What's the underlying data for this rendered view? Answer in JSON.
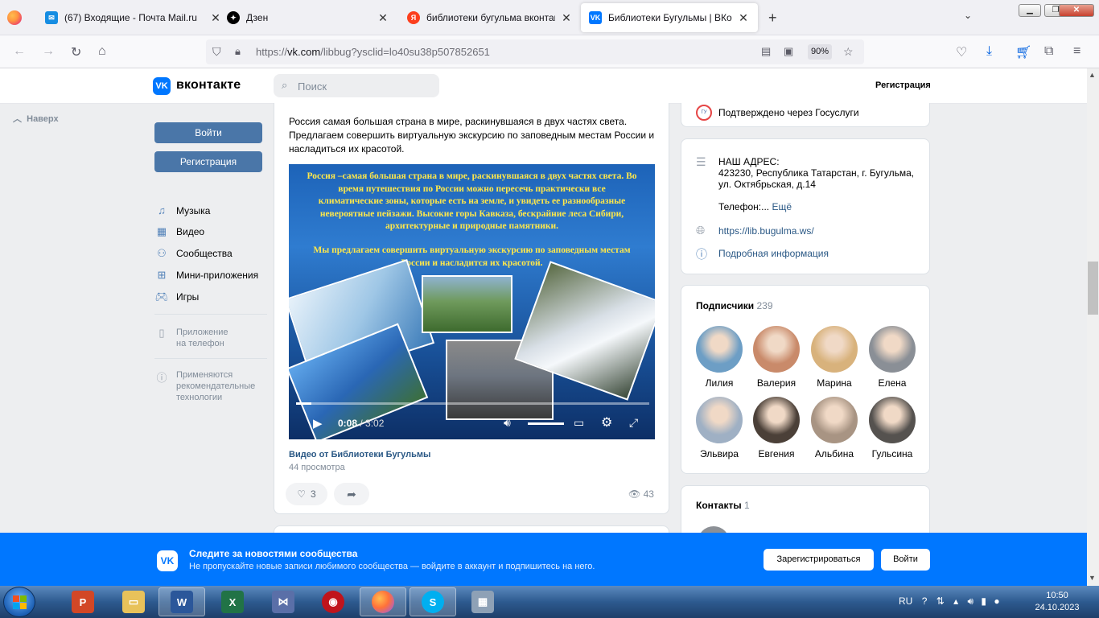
{
  "browser": {
    "tabs": [
      {
        "title": "(67) Входящие - Почта Mail.ru"
      },
      {
        "title": "Дзен"
      },
      {
        "title": "библиотеки бугульма вконтакте"
      },
      {
        "title": "Библиотеки Бугульмы | ВКонтакте"
      }
    ],
    "url_prefix": "https://",
    "url_host": "vk.com",
    "url_path": "/libbug?ysclid=lo40su38p507852651",
    "zoom": "90%"
  },
  "vk": {
    "brand": "вконтакте",
    "search_placeholder": "Поиск",
    "register_top": "Регистрация",
    "back_to_top": "Наверх",
    "login_button": "Войти",
    "register_button": "Регистрация",
    "menu": [
      {
        "label": "Музыка"
      },
      {
        "label": "Видео"
      },
      {
        "label": "Сообщества"
      },
      {
        "label": "Мини-приложения"
      },
      {
        "label": "Игры"
      }
    ],
    "app_line1": "Приложение",
    "app_line2": "на телефон",
    "rec_line1": "Применяются",
    "rec_line2": "рекомендательные",
    "rec_line3": "технологии"
  },
  "post": {
    "text": "Россия самая большая страна в мире, раскинувшаяся в двух частях света. Предлагаем совершить виртуальную экскурсию по заповедным местам России и насладиться их красотой.",
    "video_text_1": "Россия –самая большая страна в мире, раскинувшаяся в двух частях света. Во время путешествия по России можно пересечь практически все климатические зоны, которые есть на земле, и увидеть ее разнообразные невероятные пейзажи. Высокие горы Кавказа, бескрайние леса Сибири, архитектурные и природные памятники.",
    "video_text_2": "Мы предлагаем совершить виртуальную экскурсию по заповедным местам России  и насладится их красотой.",
    "video_time_current": "0:08",
    "video_time_total": "/ 3:02",
    "video_progress": 0.044,
    "video_title": "Видео от Библиотеки Бугульмы",
    "video_views": "44 просмотра",
    "likes": "3",
    "views": "43"
  },
  "right": {
    "verified": "Подтверждено через Госуслуги",
    "address_title": "НАШ АДРЕС:",
    "address_line1": "423230, Республика Татарстан, г. Бугульма,",
    "address_line2": "ул. Октябрьская, д.14",
    "phone_label": "Телефон:...",
    "phone_more": "Ещё",
    "website": "https://lib.bugulma.ws/",
    "details": "Подробная информация",
    "subscribers_title": "Подписчики",
    "subscribers_count": "239",
    "subscribers": [
      {
        "name": "Лилия",
        "color": "#6d9ec5"
      },
      {
        "name": "Валерия",
        "color": "#c98a6a"
      },
      {
        "name": "Марина",
        "color": "#d8b27c"
      },
      {
        "name": "Елена",
        "color": "#8a8f96"
      },
      {
        "name": "Эльвира",
        "color": "#9fb0c4"
      },
      {
        "name": "Евгения",
        "color": "#4b4038"
      },
      {
        "name": "Альбина",
        "color": "#a89483"
      },
      {
        "name": "Гульсина",
        "color": "#55524f"
      }
    ],
    "contacts_title": "Контакты",
    "contacts_count": "1"
  },
  "promo": {
    "title": "Следите за новостями сообщества",
    "text": "Не пропускайте новые записи любимого сообщества — войдите в аккаунт и подпишитесь на него.",
    "register": "Зарегистрироваться",
    "login": "Войти"
  },
  "taskbar": {
    "lang": "RU",
    "time": "10:50",
    "date": "24.10.2023"
  },
  "colors": {
    "vk_blue": "#0077ff",
    "vk_button": "#4a76a8",
    "link": "#2a5885"
  }
}
